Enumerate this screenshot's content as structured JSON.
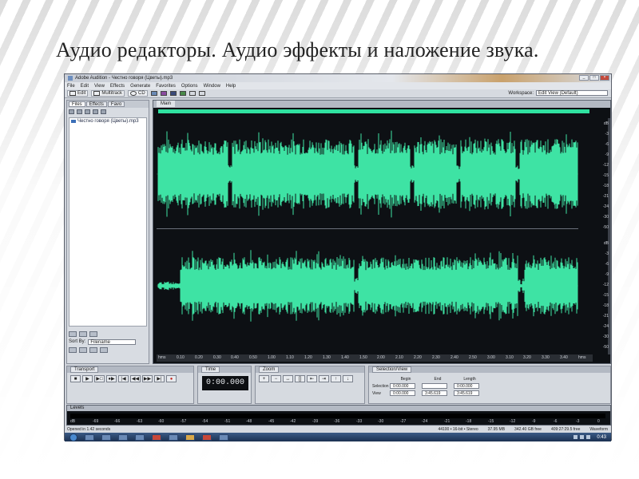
{
  "slide": {
    "title": "Аудио редакторы. Аудио эффекты и наложение звука."
  },
  "window": {
    "title": "Adobe Audition - Честно говоря (Цветы).mp3",
    "controls": [
      "_",
      "□",
      "×"
    ]
  },
  "menu": [
    "File",
    "Edit",
    "View",
    "Effects",
    "Generate",
    "Favorites",
    "Options",
    "Window",
    "Help"
  ],
  "toolbar": {
    "edit_label": "Edit",
    "multitrack_label": "Multitrack",
    "cd_label": "CD",
    "workspace_label": "Workspace:",
    "workspace_value": "Edit View (Default)"
  },
  "left_panel": {
    "tabs": [
      "Files",
      "Effects",
      "Favo"
    ],
    "files": [
      "Честно говоря (Цветы).mp3"
    ],
    "sort_label": "Sort By:",
    "sort_value": "Filename"
  },
  "editor": {
    "tab_label": "Main",
    "time_ticks": [
      "hms",
      "0.10",
      "0.20",
      "0.30",
      "0.40",
      "0.50",
      "1.00",
      "1.10",
      "1.20",
      "1.30",
      "1.40",
      "1.50",
      "2.00",
      "2.10",
      "2.20",
      "2.30",
      "2.40",
      "2.50",
      "3.00",
      "3.10",
      "3.20",
      "3.30",
      "3.40",
      "hms"
    ],
    "db_ticks": [
      "dB",
      "-3",
      "-6",
      "-9",
      "-12",
      "-15",
      "-18",
      "-21",
      "-24",
      "-30",
      "-50"
    ]
  },
  "transport": {
    "tab_label": "Transport",
    "buttons": [
      "■",
      "▶",
      "▶□",
      "●▶",
      "|◀",
      "◀◀",
      "▶▶",
      "▶|",
      "●"
    ]
  },
  "time_panel": {
    "tab_label": "Time",
    "value": "0:00.000"
  },
  "zoom_panel": {
    "tab_label": "Zoom"
  },
  "selection_panel": {
    "tab_label": "Selection/View",
    "headers": [
      "Begin",
      "End",
      "Length"
    ],
    "rows": [
      {
        "label": "Selection",
        "begin": "0:00.000",
        "end": "",
        "length": "0:00.000"
      },
      {
        "label": "View",
        "begin": "0:00.000",
        "end": "3:45.619",
        "length": "3:45.619"
      }
    ]
  },
  "levels": {
    "tab_label": "Levels",
    "scale": [
      "dB",
      "-69",
      "-66",
      "-63",
      "-60",
      "-57",
      "-54",
      "-51",
      "-48",
      "-45",
      "-42",
      "-39",
      "-36",
      "-33",
      "-30",
      "-27",
      "-24",
      "-21",
      "-18",
      "-15",
      "-12",
      "-9",
      "-6",
      "-3",
      "0"
    ]
  },
  "status": {
    "left": "Opened in 1.42 seconds",
    "format": "44100 • 16-bit • Stereo",
    "size": "37.95 MB",
    "disk_free": "342.40 GB free",
    "time_free": "409:27:29.5 free",
    "view": "Waveform"
  },
  "taskbar": {
    "clock": "0:43"
  },
  "colors": {
    "waveform": "#3ee3a4",
    "editor_bg": "#0d1014"
  }
}
